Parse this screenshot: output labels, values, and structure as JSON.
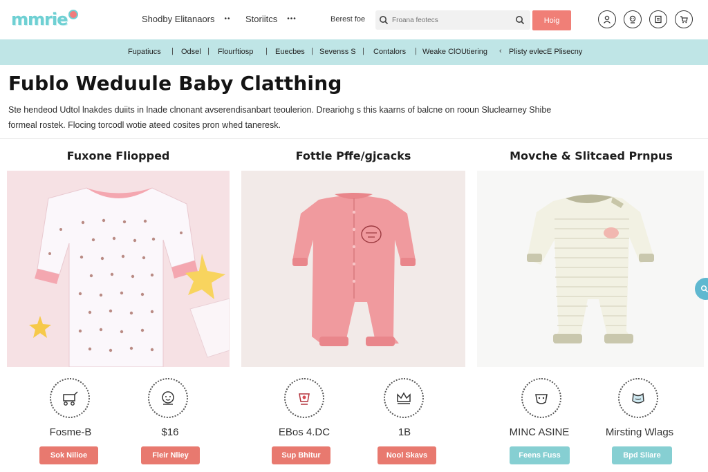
{
  "header": {
    "logo_text": "mmrie",
    "nav": [
      {
        "label": "Shodby Elitanaors",
        "dots": "••"
      },
      {
        "label": "Storiitcs",
        "dots": "•••"
      }
    ],
    "best_for": "Berest foe",
    "search": {
      "placeholder": "Froana feotecs",
      "value": ""
    },
    "search_button": "Hoig",
    "icons": [
      "account-icon",
      "baby-icon",
      "wishlist-icon",
      "cart-icon"
    ]
  },
  "categories": [
    "Fupatiucs",
    "Odsel",
    "Flourftiosp",
    "Euecbes",
    "Sevenss S",
    "Contalors",
    "Weake ClOUtiering",
    "Plisty evlecE Plisecny"
  ],
  "hero": {
    "title": "Fublo Weduule Baby Clatthing",
    "description_line1": "Ste hendeod Udtol lnakdes duiits in lnade clnonant avserendisanbart teoulerion. Dreariohɡ s this kaarns of balcne on rooun Sluclearney Shibe",
    "description_line2": "formeal rostek. Flocing torcodl wotie ateed cosites pron whed taneresk."
  },
  "products": [
    {
      "title": "Fuxone Fliopped",
      "color": "#f3a3a8"
    },
    {
      "title": "Fottle Pffe/ɡjcacks",
      "color": "#ee8f93"
    },
    {
      "title": "Movche & Slitcaed Prnpus",
      "color": "#e6e6d4"
    }
  ],
  "features": [
    {
      "label": "Fosme-B",
      "button": "Sok Nilioe",
      "button_style": "red"
    },
    {
      "label": "$16",
      "button": "Fleir Nliey",
      "button_style": "red"
    },
    {
      "label": "EBos 4.DC",
      "button": "Sup Bhitur",
      "button_style": "red"
    },
    {
      "label": "1B",
      "button": "Nool Skavs",
      "button_style": "red"
    },
    {
      "label": "MINC ASINE",
      "button": "Feens Fuss",
      "button_style": "teal"
    },
    {
      "label": "Mirsting Wlags",
      "button": "Bpd Sliare",
      "button_style": "teal"
    }
  ],
  "colors": {
    "accent_red": "#e8796f",
    "accent_teal": "#86cfd2",
    "category_bar": "#bfe5e6"
  }
}
